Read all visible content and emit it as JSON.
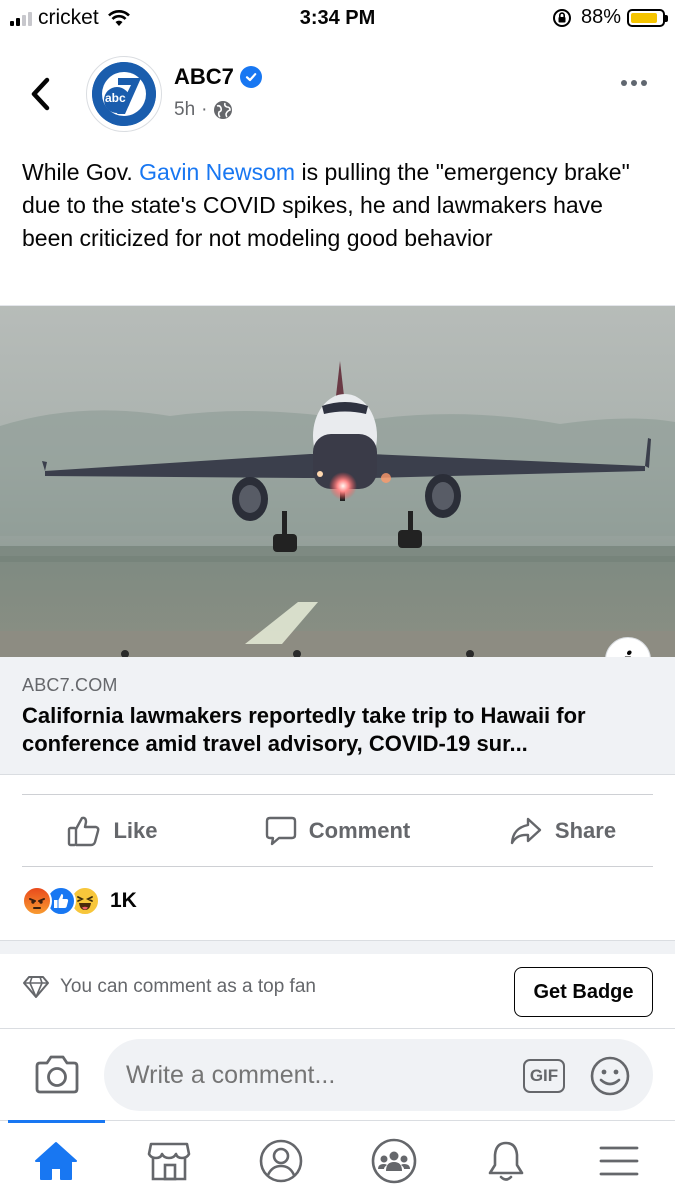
{
  "status_bar": {
    "carrier": "cricket",
    "time": "3:34 PM",
    "battery": "88%",
    "battery_level": 0.88
  },
  "post": {
    "page_name": "ABC7",
    "avatar_text": "abc",
    "avatar_number": "7",
    "verified": true,
    "time_ago": "5h",
    "separator": "·",
    "audience_icon": "globe-icon",
    "caption_before": "While Gov. ",
    "caption_mention": "Gavin Newsom",
    "caption_after": " is pulling the \"emergency brake\" due to the state's COVID spikes, he and lawmakers have been criticized for not modeling good behavior"
  },
  "link": {
    "image_alt": "Passenger jet taking off from runway",
    "info_label": "i",
    "domain": "ABC7.COM",
    "title": "California lawmakers reportedly take trip to Hawaii for conference amid travel advisory, COVID-19 sur..."
  },
  "actions": {
    "like": "Like",
    "comment": "Comment",
    "share": "Share"
  },
  "reactions": {
    "icons": [
      "angry-reaction-icon",
      "like-reaction-icon",
      "haha-reaction-icon"
    ],
    "count": "1K"
  },
  "top_fan": {
    "text": "You can comment as a top fan",
    "button": "Get Badge"
  },
  "comment_box": {
    "placeholder": "Write a comment...",
    "gif": "GIF"
  },
  "tabbar": {
    "items": [
      "home-icon",
      "marketplace-icon",
      "profile-icon",
      "groups-icon",
      "notifications-icon",
      "menu-icon"
    ],
    "active": "home-icon"
  },
  "colors": {
    "facebook_blue": "#1877f2",
    "secondary_text": "#65676b",
    "link_card_bg": "#f0f2f5",
    "battery_fill": "#f5c400"
  }
}
